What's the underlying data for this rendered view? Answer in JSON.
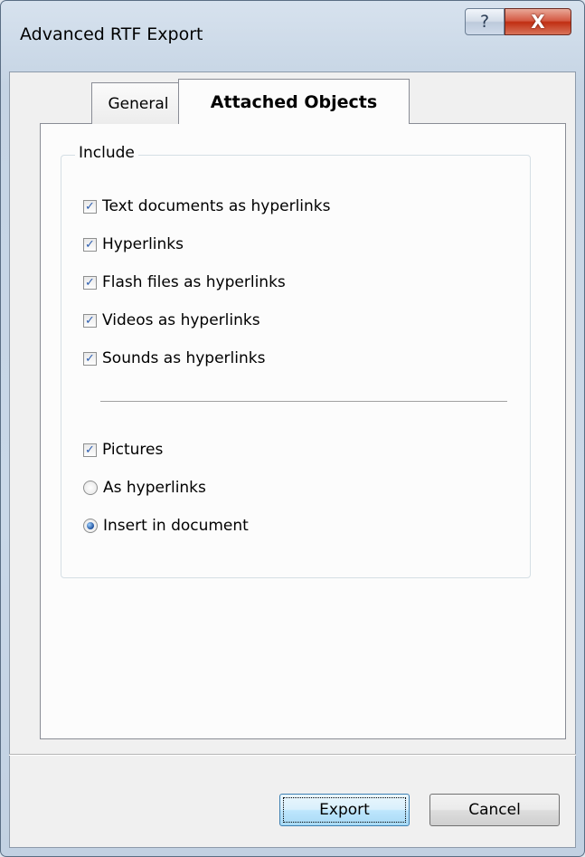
{
  "window": {
    "title": "Advanced RTF Export",
    "help_label": "?",
    "close_label": "X"
  },
  "tabs": [
    {
      "label": "General",
      "active": false
    },
    {
      "label": "Attached Objects",
      "active": true
    }
  ],
  "group": {
    "label": "Include",
    "checkboxes": [
      {
        "label": "Text documents as hyperlinks",
        "checked": true
      },
      {
        "label": "Hyperlinks",
        "checked": true
      },
      {
        "label": "Flash files as hyperlinks",
        "checked": true
      },
      {
        "label": "Videos as hyperlinks",
        "checked": true
      },
      {
        "label": "Sounds as hyperlinks",
        "checked": true
      }
    ],
    "pictures": {
      "label": "Pictures",
      "checked": true
    },
    "radios": [
      {
        "label": "As hyperlinks",
        "selected": false
      },
      {
        "label": "Insert in document",
        "selected": true
      }
    ]
  },
  "buttons": {
    "export_label": "Export",
    "cancel_label": "Cancel"
  },
  "check_glyph": "✓"
}
